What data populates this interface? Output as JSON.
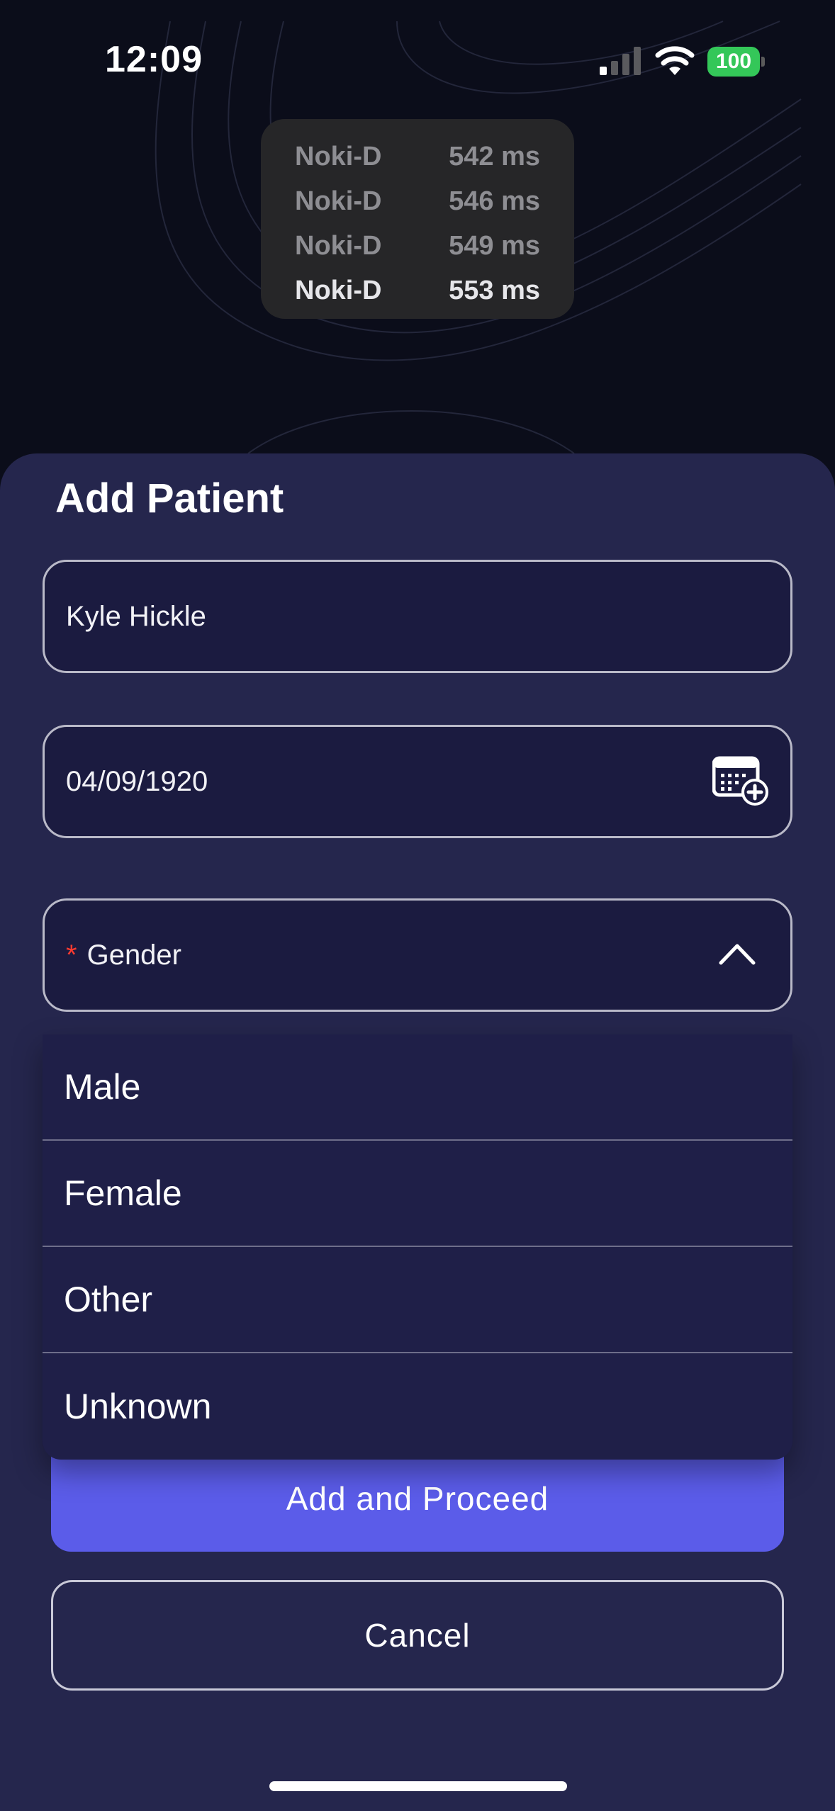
{
  "status_bar": {
    "time": "12:09",
    "battery": "100",
    "icons": [
      "cellular-signal-icon",
      "wifi-icon",
      "battery-icon"
    ]
  },
  "latency_overlay": {
    "rows": [
      {
        "device": "Noki-D",
        "latency": "542 ms"
      },
      {
        "device": "Noki-D",
        "latency": "546 ms"
      },
      {
        "device": "Noki-D",
        "latency": "549 ms"
      },
      {
        "device": "Noki-D",
        "latency": "553 ms"
      }
    ]
  },
  "sheet": {
    "title": "Add Patient",
    "name_field": {
      "value": "Kyle Hickle"
    },
    "dob_field": {
      "value": "04/09/1920",
      "icon": "calendar-add-icon"
    },
    "gender_field": {
      "required_mark": "*",
      "placeholder": "Gender",
      "icon": "chevron-up-icon"
    },
    "gender_options": [
      "Male",
      "Female",
      "Other",
      "Unknown"
    ],
    "primary_button": "Add and Proceed",
    "secondary_button": "Cancel"
  },
  "colors": {
    "background": "#0b0d1a",
    "sheet": "#25264d",
    "field": "#1b1b40",
    "accent": "#5b5ce9",
    "required": "#ff3b30",
    "battery": "#34c759"
  }
}
